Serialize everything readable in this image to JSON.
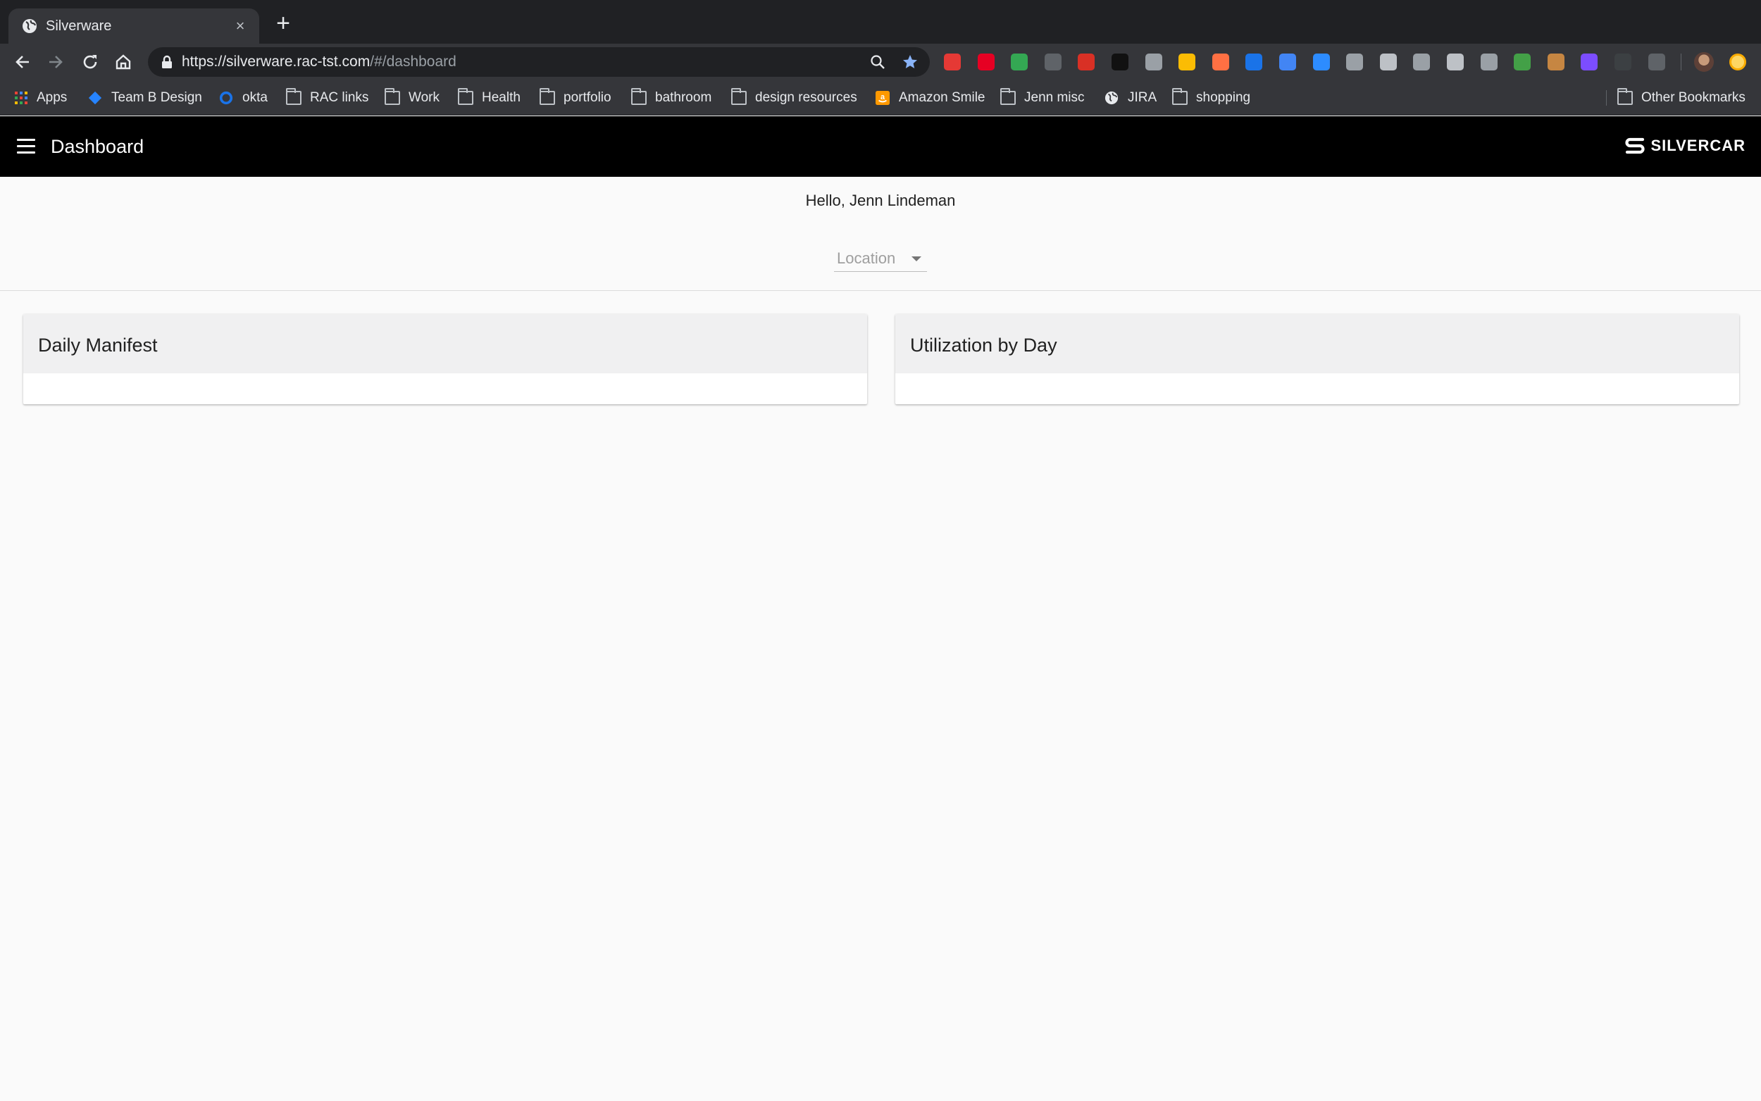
{
  "browser": {
    "tab": {
      "title": "Silverware",
      "close_label": "×"
    },
    "new_tab_label": "+",
    "url": {
      "main": "https://silverware.rac-tst.com",
      "path": "/#/dashboard"
    },
    "extensions": [
      {
        "name": "ext-red-hand-icon",
        "color": "#e53935"
      },
      {
        "name": "ext-pinterest-icon",
        "color": "#e60023"
      },
      {
        "name": "ext-screenshot-icon",
        "color": "#34a853"
      },
      {
        "name": "ext-grey-icon",
        "color": "#5f6368"
      },
      {
        "name": "ext-calendar-icon",
        "color": "#d93025"
      },
      {
        "name": "ext-bird-icon",
        "color": "#111111"
      },
      {
        "name": "ext-qr-icon",
        "color": "#9aa0a6"
      },
      {
        "name": "ext-color-wheel-icon",
        "color": "#fbbc04"
      },
      {
        "name": "ext-rainbow-icon",
        "color": "#ff7043"
      },
      {
        "name": "ext-blue-circle-icon",
        "color": "#1a73e8"
      },
      {
        "name": "ext-link-icon",
        "color": "#4285f4"
      },
      {
        "name": "ext-zoom-icon",
        "color": "#2d8cff"
      },
      {
        "name": "ext-monitor-icon",
        "color": "#9aa0a6"
      },
      {
        "name": "ext-camera-icon",
        "color": "#bdc1c6"
      },
      {
        "name": "ext-u-icon",
        "color": "#9aa0a6"
      },
      {
        "name": "ext-page-icon",
        "color": "#bdc1c6"
      },
      {
        "name": "ext-speech-icon",
        "color": "#9aa0a6"
      },
      {
        "name": "ext-pen-icon",
        "color": "#43a047"
      },
      {
        "name": "ext-cookie-icon",
        "color": "#c68642"
      },
      {
        "name": "ext-dots-icon",
        "color": "#7c4dff"
      },
      {
        "name": "ext-dark-icon",
        "color": "#3c4043"
      },
      {
        "name": "ext-wt-icon",
        "color": "#5f6368"
      }
    ],
    "bookmarks": {
      "apps": "Apps",
      "items": [
        "Team B Design",
        "okta",
        "RAC links",
        "Work",
        "Health",
        "portfolio",
        "bathroom",
        "design resources",
        "Amazon Smile",
        "Jenn misc",
        "JIRA",
        "shopping"
      ],
      "other": "Other Bookmarks"
    }
  },
  "app": {
    "title": "Dashboard",
    "brand": "SILVERCAR",
    "greeting": "Hello, Jenn Lindeman",
    "location_placeholder": "Location",
    "cards": [
      "Daily Manifest",
      "Utilization by Day"
    ]
  },
  "colors": {
    "appbar": "#000000",
    "card_header": "#f0f0f1",
    "page_bg": "#fafafa"
  }
}
